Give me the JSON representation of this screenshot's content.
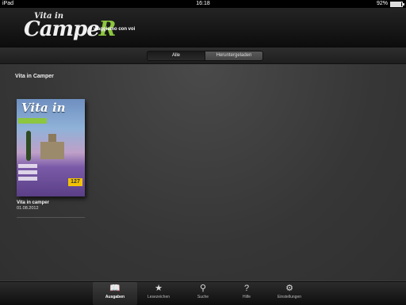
{
  "status": {
    "carrier": "iPad",
    "time": "16:18",
    "battery": "92%",
    "battery_level": 0.92
  },
  "header": {
    "logo_top": "Vita in",
    "logo_main": "Campe",
    "logo_r": "R",
    "tagline": "viaggiamo con voi"
  },
  "filter": {
    "all_label": "Alle",
    "downloaded_label": "Heruntergeladen",
    "selected": "Alle"
  },
  "section": {
    "title": "Vita in Camper"
  },
  "issues": [
    {
      "name": "Vita in camper",
      "date": "01.08.2012",
      "cover_title": "Vita in",
      "cover_badge": "127"
    }
  ],
  "tabbar": {
    "items": [
      {
        "label": "Ausgaben",
        "icon": "book-icon"
      },
      {
        "label": "Lesezeichen",
        "icon": "star-icon"
      },
      {
        "label": "Suche",
        "icon": "search-icon"
      },
      {
        "label": "Hilfe",
        "icon": "help-icon"
      },
      {
        "label": "Einstellungen",
        "icon": "gear-icon"
      }
    ],
    "selected": "Ausgaben"
  },
  "colors": {
    "accent": "#8dc63f",
    "background": "#3a3a3a"
  }
}
